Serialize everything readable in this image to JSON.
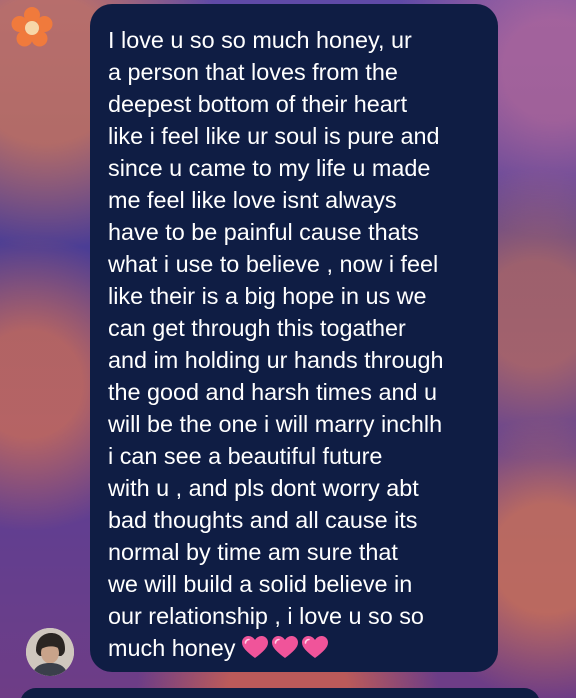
{
  "message": {
    "lines": [
      "I love u so so much honey, ur",
      "a person that loves from the",
      "deepest bottom of their heart",
      "like i feel like ur soul is pure and",
      "since u came to my life u made",
      "me feel like love isnt always",
      "have to be painful cause thats",
      "what i use to believe , now i feel",
      "like their is a big hope in us we",
      "can get through this togather",
      "and im holding ur hands through",
      "the good and harsh times and u",
      "will be the one i will marry inchlh",
      "i can see a beautiful future",
      "with u , and pls dont worry abt",
      "bad thoughts and all cause its",
      "normal by time am sure that",
      "we will build a solid believe in",
      "our relationship , i love u so so",
      "much honey"
    ],
    "emoji": [
      "pink-heart-icon",
      "pink-heart-icon",
      "pink-heart-icon"
    ]
  },
  "colors": {
    "bubble": "#0f1d44",
    "text": "#ffffff",
    "heart": "#f0549a",
    "flower": "#f07a3c"
  }
}
